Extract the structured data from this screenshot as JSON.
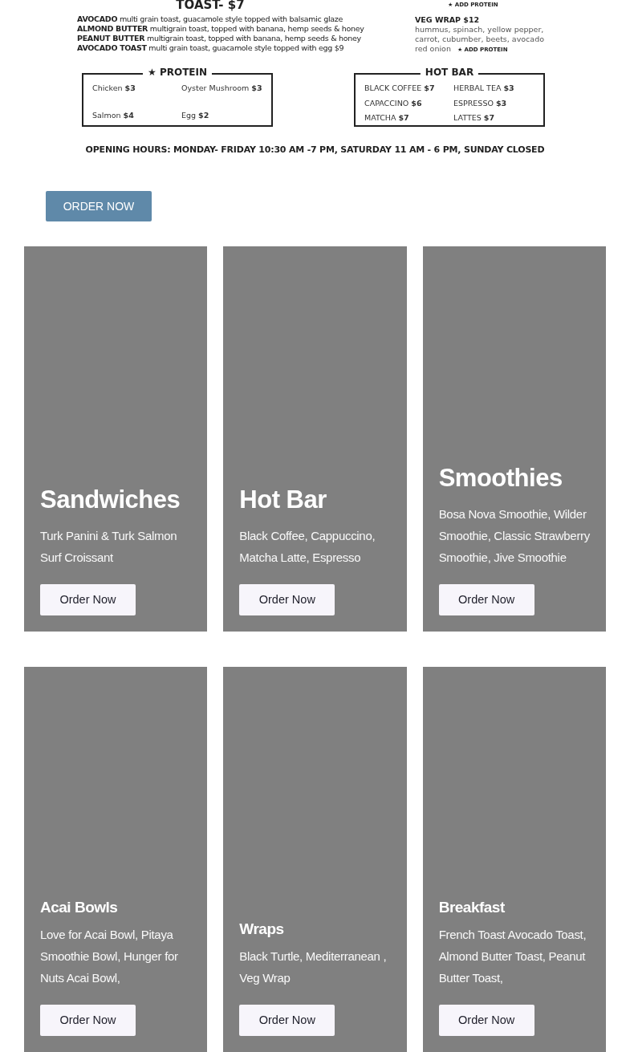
{
  "menu_image": {
    "title": "TOAST- $7",
    "toast_items": [
      "**AVOCADO** multi grain toast, guacamole style topped with balsamic glaze",
      "**ALMOND BUTTER** multigrain toast, topped with banana, hemp seeds & honey",
      "**PEANUT BUTTER** multigrain toast, topped with banana, hemp seeds & honey",
      "**AVOCADO TOAST** multi grain toast, guacamole style topped with egg $9"
    ],
    "top_note": "★ ADD PROTEIN",
    "veg_wrap": {
      "name": "VEG WRAP $12",
      "lines": [
        "hummus, spinach, yellow pepper,",
        "carrot, cubumber, beets, avocado",
        "red onion"
      ],
      "note": "★ ADD PROTEIN"
    },
    "protein": {
      "title": "★ PROTEIN",
      "items": [
        "Chicken **$3**",
        "Oyster Mushroom **$3**",
        "Salmon **$4**",
        "Egg **$2**"
      ]
    },
    "hot_bar": {
      "title": "HOT BAR",
      "items": [
        "BLACK COFFEE **$7**",
        "HERBAL TEA **$3**",
        "CAPACCINO **$6**",
        "ESPRESSO **$3**",
        "MATCHA **$7**",
        "LATTES **$7**"
      ]
    },
    "hours": "OPENING HOURS: MONDAY- FRIDAY 10:30 AM -7 PM, SATURDAY 11 AM - 6 PM, SUNDAY CLOSED"
  },
  "order_button": "ORDER NOW",
  "card_rows": [
    {
      "kind": "large",
      "cards": [
        {
          "title": "Sandwiches",
          "text": "Turk Panini & Turk Salmon Surf Croissant",
          "button": "Order Now"
        },
        {
          "title": "Hot Bar",
          "text": "Black Coffee, Cappuccino, Matcha Latte, Espresso",
          "button": "Order Now"
        },
        {
          "title": "Smoothies",
          "text": "Bosa Nova Smoothie, Wilder Smoothie, Classic Strawberry Smoothie, Jive Smoothie",
          "button": "Order Now"
        }
      ]
    },
    {
      "kind": "small",
      "cards": [
        {
          "title": "Acai Bowls",
          "text": "Love for Acai Bowl, Pitaya Smoothie Bowl, Hunger for Nuts Acai Bowl,",
          "button": "Order Now"
        },
        {
          "title": "Wraps",
          "text": "Black Turtle, Mediterranean , Veg Wrap",
          "button": "Order Now"
        },
        {
          "title": "Breakfast",
          "text": "French Toast Avocado Toast, Almond Butter Toast, Peanut Butter Toast,",
          "button": "Order Now"
        }
      ]
    }
  ]
}
